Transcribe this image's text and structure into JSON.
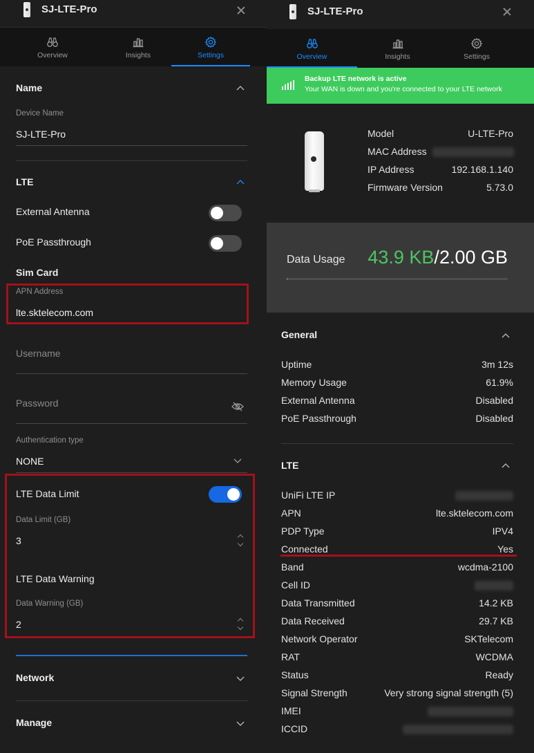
{
  "left": {
    "title": "SJ-LTE-Pro",
    "tabs": [
      {
        "label": "Overview",
        "icon": "binoculars-icon",
        "active": false
      },
      {
        "label": "Insights",
        "icon": "bar-chart-icon",
        "active": false
      },
      {
        "label": "Settings",
        "icon": "gear-icon",
        "active": true
      }
    ],
    "name_section": {
      "heading": "Name",
      "device_name_label": "Device Name",
      "device_name_value": "SJ-LTE-Pro"
    },
    "lte_section": {
      "heading": "LTE",
      "external_antenna_label": "External Antenna",
      "external_antenna_on": false,
      "poe_label": "PoE Passthrough",
      "poe_on": false,
      "sim_card_label": "Sim Card",
      "apn_label": "APN Address",
      "apn_value": "lte.sktelecom.com",
      "username_placeholder": "Username",
      "password_placeholder": "Password",
      "auth_label": "Authentication type",
      "auth_value": "NONE",
      "data_limit_toggle_label": "LTE Data Limit",
      "data_limit_on": true,
      "data_limit_label": "Data Limit (GB)",
      "data_limit_value": "3",
      "data_warning_heading": "LTE Data Warning",
      "data_warning_label": "Data Warning (GB)",
      "data_warning_value": "2"
    },
    "network_heading": "Network",
    "manage_heading": "Manage"
  },
  "right": {
    "title": "SJ-LTE-Pro",
    "tabs": [
      {
        "label": "Overview",
        "icon": "binoculars-icon",
        "active": true
      },
      {
        "label": "Insights",
        "icon": "bar-chart-icon",
        "active": false
      },
      {
        "label": "Settings",
        "icon": "gear-icon",
        "active": false
      }
    ],
    "banner": {
      "title": "Backup LTE network is active",
      "subtitle": "Your WAN is down and you're connected to your LTE network",
      "color": "#3ecb5d"
    },
    "device_info": [
      {
        "label": "Model",
        "value": "U-LTE-Pro"
      },
      {
        "label": "MAC Address",
        "value": ""
      },
      {
        "label": "IP Address",
        "value": "192.168.1.140"
      },
      {
        "label": "Firmware Version",
        "value": "5.73.0"
      }
    ],
    "usage": {
      "label": "Data Usage",
      "used": "43.9 KB",
      "separator": "/",
      "total": "2.00 GB",
      "fraction": 2e-05
    },
    "general": {
      "heading": "General",
      "rows": [
        {
          "label": "Uptime",
          "value": "3m 12s"
        },
        {
          "label": "Memory Usage",
          "value": "61.9%"
        },
        {
          "label": "External Antenna",
          "value": "Disabled"
        },
        {
          "label": "PoE Passthrough",
          "value": "Disabled"
        }
      ]
    },
    "lte": {
      "heading": "LTE",
      "rows": [
        {
          "label": "UniFi LTE IP",
          "value": ""
        },
        {
          "label": "APN",
          "value": "lte.sktelecom.com"
        },
        {
          "label": "PDP Type",
          "value": "IPV4"
        },
        {
          "label": "Connected",
          "value": "Yes"
        },
        {
          "label": "Band",
          "value": "wcdma-2100"
        },
        {
          "label": "Cell ID",
          "value": ""
        },
        {
          "label": "Data Transmitted",
          "value": "14.2 KB"
        },
        {
          "label": "Data Received",
          "value": "29.7 KB"
        },
        {
          "label": "Network Operator",
          "value": "SKTelecom"
        },
        {
          "label": "RAT",
          "value": "WCDMA"
        },
        {
          "label": "Status",
          "value": "Ready"
        },
        {
          "label": "Signal Strength",
          "value": "Very strong signal strength (5)"
        },
        {
          "label": "IMEI",
          "value": ""
        },
        {
          "label": "ICCID",
          "value": ""
        }
      ]
    }
  },
  "colors": {
    "accent": "#1a8cff",
    "highlight": "#a3111b",
    "toggle_on": "#1668e3",
    "usage_green": "#4cc563"
  }
}
